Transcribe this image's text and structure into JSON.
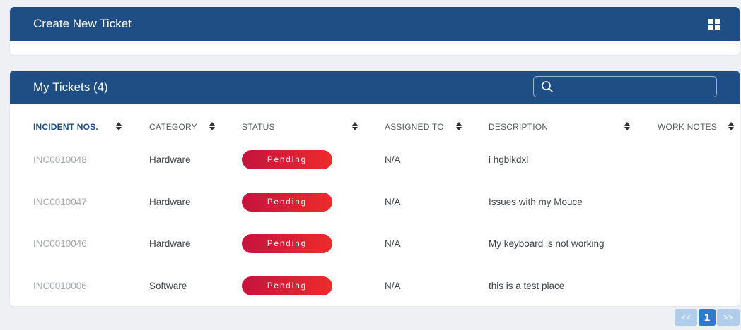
{
  "create_panel": {
    "title": "Create New Ticket"
  },
  "tickets_panel": {
    "title": "My Tickets (4)",
    "search": {
      "placeholder": "",
      "value": ""
    }
  },
  "columns": [
    {
      "label": "INCIDENT NOS.",
      "sortable": true
    },
    {
      "label": "CATEGORY",
      "sortable": true
    },
    {
      "label": "STATUS",
      "sortable": true
    },
    {
      "label": "ASSIGNED TO",
      "sortable": true
    },
    {
      "label": "DESCRIPTION",
      "sortable": true
    },
    {
      "label": "WORK NOTES",
      "sortable": true
    }
  ],
  "rows": [
    {
      "incident": "INC0010048",
      "category": "Hardware",
      "status": "Pending",
      "assigned": "N/A",
      "description": "i hgbikdxl",
      "notes": ""
    },
    {
      "incident": "INC0010047",
      "category": "Hardware",
      "status": "Pending",
      "assigned": "N/A",
      "description": "Issues with my Mouce",
      "notes": ""
    },
    {
      "incident": "INC0010046",
      "category": "Hardware",
      "status": "Pending",
      "assigned": "N/A",
      "description": "My keyboard is not working",
      "notes": ""
    },
    {
      "incident": "INC0010006",
      "category": "Software",
      "status": "Pending",
      "assigned": "N/A",
      "description": "this is a test place",
      "notes": ""
    }
  ],
  "pagination": {
    "prev": "<<",
    "current": "1",
    "next": ">>"
  },
  "colors": {
    "header": "#1f4e85",
    "pending_badge_start": "#c4143e",
    "pending_badge_end": "#ee2b2b",
    "page_current": "#2d7bd0",
    "page_nav": "#b0cdeb"
  },
  "icons": {
    "panel_menu": "grid-icon",
    "search": "search-icon",
    "sort": "sort-icon"
  }
}
